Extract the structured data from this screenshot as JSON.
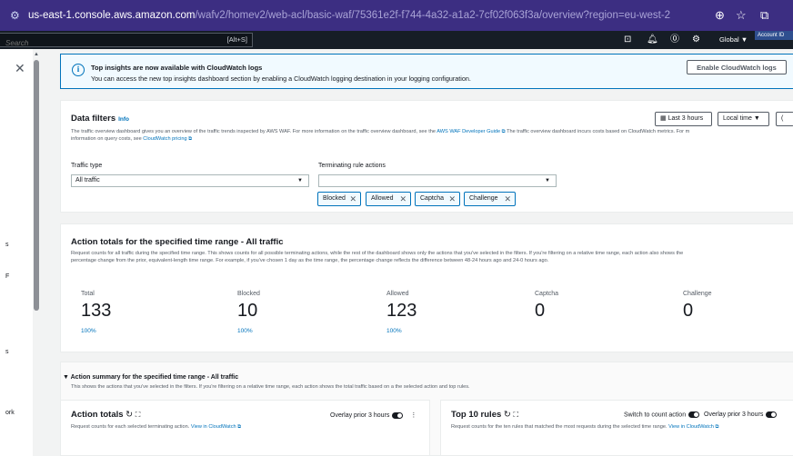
{
  "browser": {
    "url_host": "us-east-1.console.aws.amazon.com",
    "url_path": "/wafv2/homev2/web-acl/basic-waf/75361e2f-f744-4a32-a1a2-7cf02f063f3a/overview?region=eu-west-2"
  },
  "awsbar": {
    "search_placeholder": "Search",
    "search_shortcut": "[Alt+S]",
    "region": "Global ▼",
    "account": "Account ID"
  },
  "leftnav": {
    "fragments": [
      "s",
      "F",
      "s",
      "ork"
    ]
  },
  "banner": {
    "title": "Top insights are now available with CloudWatch logs",
    "description": "You can access the new top insights dashboard section by enabling a CloudWatch logging destination in your logging configuration.",
    "button": "Enable CloudWatch logs"
  },
  "filters": {
    "title": "Data filters",
    "info": "Info",
    "desc_1": "The traffic overview dashboard gives you an overview of the traffic trends inspected by AWS WAF. For more information on the traffic overview dashboard, see the",
    "desc_link": "AWS WAF Developer Guide",
    "desc_2": "The traffic overview dashboard incurs costs based on CloudWatch metrics. For m",
    "desc_3": "information on query costs, see",
    "desc_link_2": "CloudWatch pricing",
    "time_range": "Last 3 hours",
    "time_zone": "Local time ▼",
    "traffic_type_label": "Traffic type",
    "traffic_type_value": "All traffic",
    "rule_actions_label": "Terminating rule actions",
    "tokens": [
      "Blocked",
      "Allowed",
      "Captcha",
      "Challenge"
    ]
  },
  "totals": {
    "title": "Action totals for the specified time range - All traffic",
    "desc_1": "Request counts for all traffic during the specified time range. This shows counts for all possible terminating actions, while the rest of the dashboard shows only the actions that you've selected in the filters. If you're filtering on a relative time range, each action also shows the",
    "desc_2": "percentage change from the prior, equivalent-length time range. For example, if you've chosen 1 day as the time range, the percentage change reflects the difference between 48-24 hours ago and 24-0 hours ago.",
    "metrics": [
      {
        "label": "Total",
        "value": "133",
        "pct": "100%"
      },
      {
        "label": "Blocked",
        "value": "10",
        "pct": "100%"
      },
      {
        "label": "Allowed",
        "value": "123",
        "pct": "100%"
      },
      {
        "label": "Captcha",
        "value": "0",
        "pct": ""
      },
      {
        "label": "Challenge",
        "value": "0",
        "pct": ""
      }
    ]
  },
  "summary": {
    "title": "Action summary for the specified time range - All traffic",
    "desc": "This shows the actions that you've selected in the filters. If you're filtering on a relative time range, each action shows the total traffic based on a the selected action and top rules.",
    "action_totals": {
      "title": "Action totals",
      "overlay": "Overlay prior 3 hours",
      "desc": "Request counts for each selected terminating action.",
      "link": "View in CloudWatch"
    },
    "top_rules": {
      "title": "Top 10 rules",
      "switch": "Switch to count action",
      "overlay": "Overlay prior 3 hours",
      "desc": "Request counts for the ten rules that matched the most requests during the selected time range.",
      "link": "View in CloudWatch"
    }
  }
}
